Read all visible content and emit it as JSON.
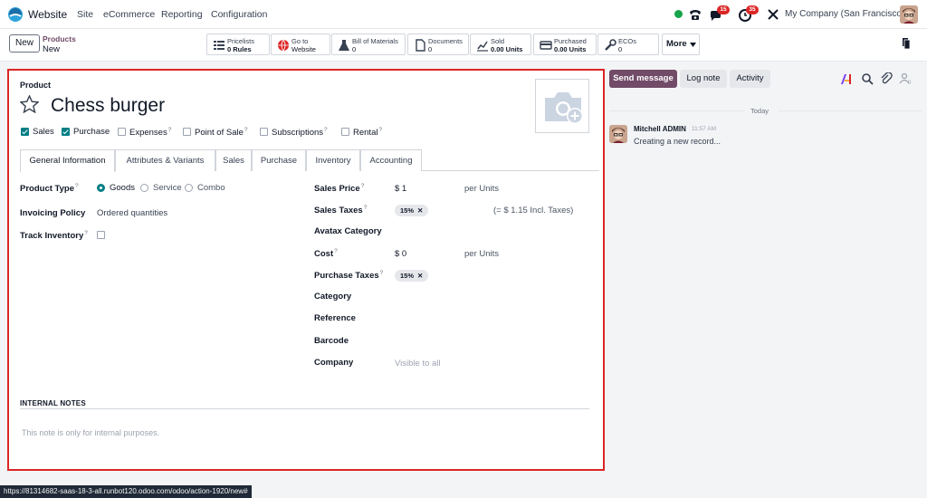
{
  "navbar": {
    "app_name": "Website",
    "menus": [
      "Site",
      "eCommerce",
      "Reporting",
      "Configuration"
    ],
    "messages_count": "15",
    "activities_count": "35",
    "company": "My Company (San Francisco)"
  },
  "control": {
    "new_label": "New",
    "breadcrumb": "Products",
    "record_name": "New",
    "more_label": "More",
    "smart_buttons": [
      {
        "icon": "list-icon",
        "line1": "Pricelists",
        "line2": "0 Rules"
      },
      {
        "icon": "globe-icon",
        "line1": "Go to",
        "line2": "Website"
      },
      {
        "icon": "flask-icon",
        "line1": "Bill of Materials",
        "line2": "0"
      },
      {
        "icon": "file-icon",
        "line1": "Documents",
        "line2": "0"
      },
      {
        "icon": "chart-icon",
        "line1": "Sold",
        "line2": "0.00 Units"
      },
      {
        "icon": "card-icon",
        "line1": "Purchased",
        "line2": "0.00 Units"
      },
      {
        "icon": "wrench-icon",
        "line1": "ECOs",
        "line2": "0"
      }
    ]
  },
  "form": {
    "product_label": "Product",
    "product_name": "Chess burger",
    "checkboxes": [
      {
        "label": "Sales",
        "checked": true
      },
      {
        "label": "Purchase",
        "checked": true
      },
      {
        "label": "Expenses",
        "checked": false,
        "help": "?"
      },
      {
        "label": "Point of Sale",
        "checked": false,
        "help": "?"
      },
      {
        "label": "Subscriptions",
        "checked": false,
        "help": "?"
      },
      {
        "label": "Rental",
        "checked": false,
        "help": "?"
      }
    ],
    "tabs": [
      "General Information",
      "Attributes & Variants",
      "Sales",
      "Purchase",
      "Inventory",
      "Accounting"
    ],
    "left_fields": {
      "product_type_label": "Product Type",
      "product_type_options": [
        "Goods",
        "Service",
        "Combo"
      ],
      "product_type_selected": "Goods",
      "invoicing_policy_label": "Invoicing Policy",
      "invoicing_policy_value": "Ordered quantities",
      "track_inventory_label": "Track Inventory"
    },
    "right_fields": {
      "sales_price_label": "Sales Price",
      "sales_price_value": "$ 1",
      "sales_price_unit": "per Units",
      "sales_taxes_label": "Sales Taxes",
      "sales_taxes_tag": "15%",
      "sales_taxes_incl": "(= $ 1.15 Incl. Taxes)",
      "avatax_label": "Avatax Category",
      "cost_label": "Cost",
      "cost_value": "$ 0",
      "cost_unit": "per Units",
      "purchase_taxes_label": "Purchase Taxes",
      "purchase_taxes_tag": "15%",
      "category_label": "Category",
      "reference_label": "Reference",
      "barcode_label": "Barcode",
      "company_label": "Company",
      "company_placeholder": "Visible to all"
    },
    "notes_title": "INTERNAL NOTES",
    "notes_placeholder": "This note is only for internal purposes."
  },
  "chatter": {
    "send_message": "Send message",
    "log_note": "Log note",
    "activity": "Activity",
    "today": "Today",
    "author": "Mitchell ADMIN",
    "time": "11:57 AM",
    "body": "Creating a new record..."
  },
  "statusbar": {
    "url": "https://81314682-saas-18-3-all.runbot120.odoo.com/odoo/action-1920/new#"
  },
  "colors": {
    "brand": "#714b67",
    "accent": "#017e84",
    "highlight_border": "#dc2626",
    "badge": "#dc2626"
  }
}
